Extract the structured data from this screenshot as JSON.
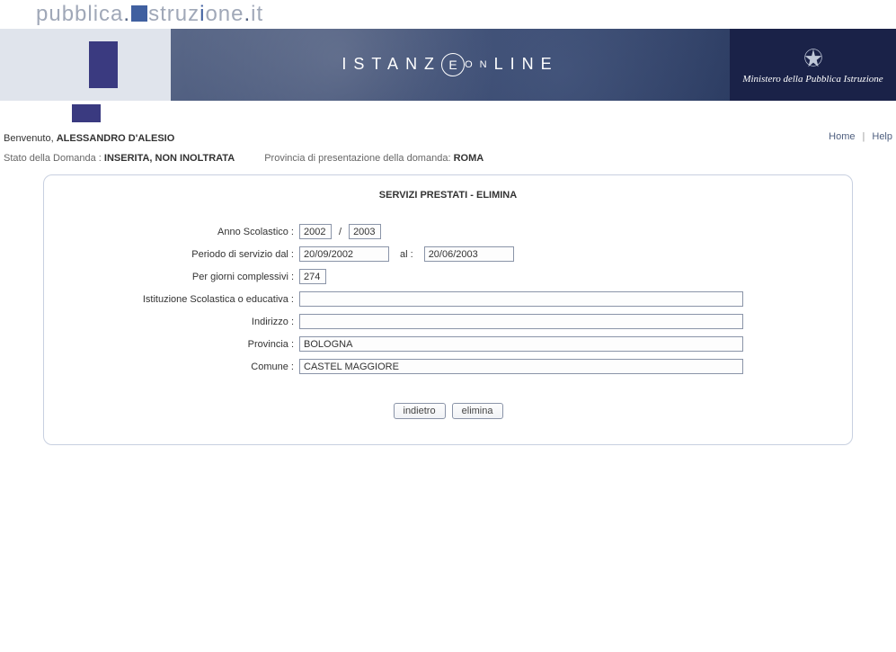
{
  "site": {
    "title_part1": "pubblica",
    "title_dot1": ".",
    "title_part2": "struz",
    "title_part3": "one",
    "title_dot2": ".",
    "title_tld": "it"
  },
  "banner": {
    "text_istanz": "ISTANZ",
    "text_e": "E",
    "text_on_small": "ON",
    "text_line": "LINE",
    "ministry": "Ministero della Pubblica Istruzione"
  },
  "nav": {
    "home": "Home",
    "help": "Help"
  },
  "user": {
    "welcome_label": "Benvenuto, ",
    "name": "ALESSANDRO D'ALESIO"
  },
  "status": {
    "domanda_label": "Stato della Domanda : ",
    "domanda_value": "INSERITA, NON INOLTRATA",
    "provincia_label": "Provincia di presentazione della domanda: ",
    "provincia_value": "ROMA"
  },
  "form": {
    "title": "SERVIZI PRESTATI - ELIMINA",
    "labels": {
      "anno_scolastico": "Anno Scolastico :",
      "periodo_dal": "Periodo di servizio dal :",
      "al": "al :",
      "giorni": "Per giorni complessivi :",
      "istituzione": "Istituzione Scolastica o educativa :",
      "indirizzo": "Indirizzo :",
      "provincia": "Provincia :",
      "comune": "Comune :"
    },
    "values": {
      "anno_from": "2002",
      "anno_to": "2003",
      "data_dal": "20/09/2002",
      "data_al": "20/06/2003",
      "giorni": "274",
      "istituzione": "",
      "indirizzo": "",
      "provincia": "BOLOGNA",
      "comune": "CASTEL MAGGIORE"
    },
    "buttons": {
      "indietro": "indietro",
      "elimina": "elimina"
    }
  }
}
